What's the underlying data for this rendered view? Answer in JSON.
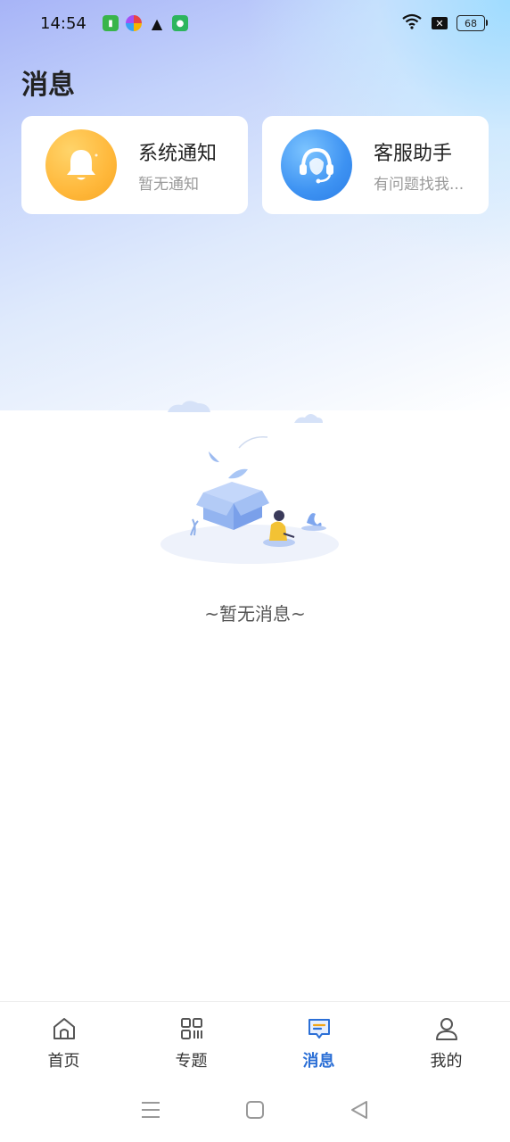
{
  "status_bar": {
    "time": "14:54",
    "battery": "68",
    "notification_icons": [
      "app-icon",
      "multicolor-app-icon",
      "warning-icon",
      "shield-icon"
    ]
  },
  "page": {
    "title": "消息",
    "empty_text": "~暂无消息~"
  },
  "cards": [
    {
      "icon": "bell-icon",
      "title": "系统通知",
      "subtitle": "暂无通知",
      "color": "#ffb83b"
    },
    {
      "icon": "headset-icon",
      "title": "客服助手",
      "subtitle": "有问题找我...",
      "color": "#3d92f2"
    }
  ],
  "tabbar": {
    "items": [
      {
        "label": "首页",
        "icon": "home-icon",
        "active": false
      },
      {
        "label": "专题",
        "icon": "grid-icon",
        "active": false
      },
      {
        "label": "消息",
        "icon": "message-icon",
        "active": true
      },
      {
        "label": "我的",
        "icon": "user-icon",
        "active": false
      }
    ],
    "active_color": "#2b6fd6"
  },
  "system_nav": [
    "menu-icon",
    "home-square-icon",
    "back-triangle-icon"
  ]
}
